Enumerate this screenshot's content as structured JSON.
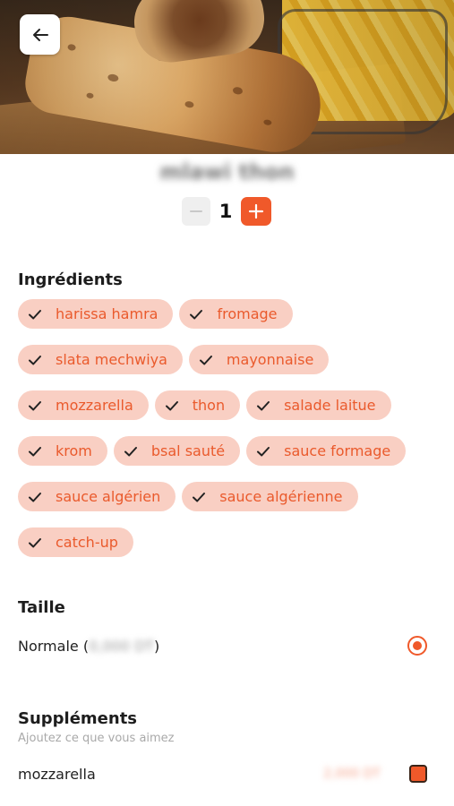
{
  "product": {
    "title": "mlawi thon",
    "quantity": "1"
  },
  "icons": {
    "back": "arrow-left-icon",
    "minus": "minus-icon",
    "plus": "plus-icon",
    "check": "check-icon"
  },
  "colors": {
    "accent": "#f0592a",
    "chip_bg": "#f9cfc3",
    "chip_text": "#ea5a2c"
  },
  "ingredients": {
    "title": "Ingrédients",
    "items": [
      "harissa hamra",
      "fromage",
      "slata mechwiya",
      "mayonnaise",
      "mozzarella",
      "thon",
      "salade laitue",
      "krom",
      "bsal sauté",
      "sauce formage",
      "sauce algérien",
      "sauce algérienne",
      "catch-up"
    ]
  },
  "size": {
    "title": "Taille",
    "option_label": "Normale (",
    "option_price": "0,000 DT",
    "option_close": ")",
    "selected": true
  },
  "supplements": {
    "title": "Suppléments",
    "subtitle": "Ajoutez ce que vous aimez",
    "items": [
      {
        "name": "mozzarella",
        "price": "2,000 DT",
        "checked": true
      }
    ]
  }
}
